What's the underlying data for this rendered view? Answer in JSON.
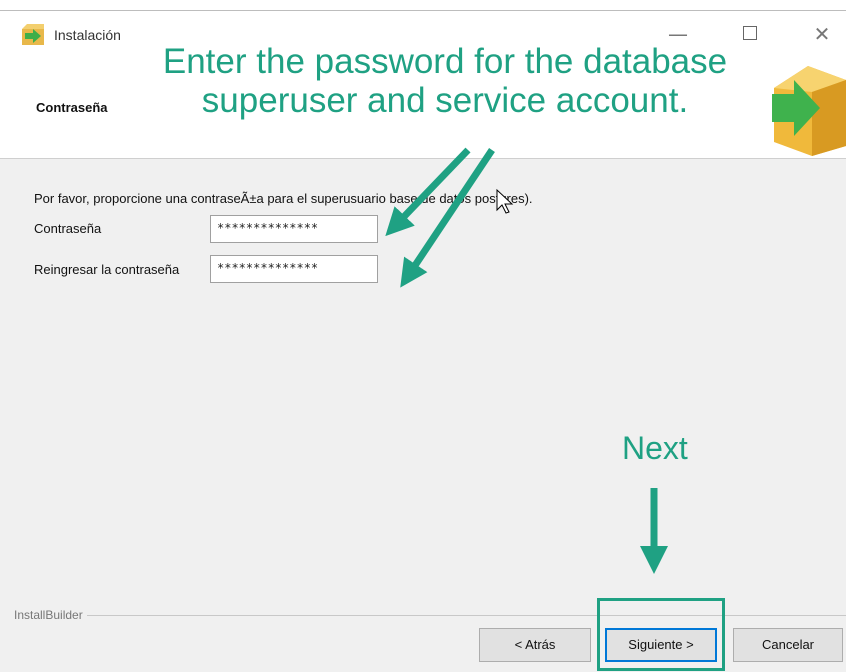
{
  "window": {
    "title": "Instalación",
    "minimize_glyph": "—",
    "close_glyph": "✕"
  },
  "header": {
    "page_heading": "Contraseña",
    "logo_icon": "installer-box-arrow-icon"
  },
  "form": {
    "instruction": "Por favor, proporcione una contraseÃ±a para el superusuario base de datos postgres).",
    "password_label": "Contraseña",
    "password_value": "**************",
    "confirm_label": "Reingresar la contraseña",
    "confirm_value": "**************"
  },
  "footer": {
    "brand": "InstallBuilder",
    "back_label": "< Atrás",
    "next_label": "Siguiente >",
    "cancel_label": "Cancelar"
  },
  "annotations": {
    "main_line1": "Enter the password for the database",
    "main_line2": "superuser and service account.",
    "next_caption": "Next",
    "color": "#1fa183"
  },
  "colors": {
    "content_bg": "#f0f0f0",
    "accent": "#1fa183",
    "focus_border": "#0078d7"
  }
}
